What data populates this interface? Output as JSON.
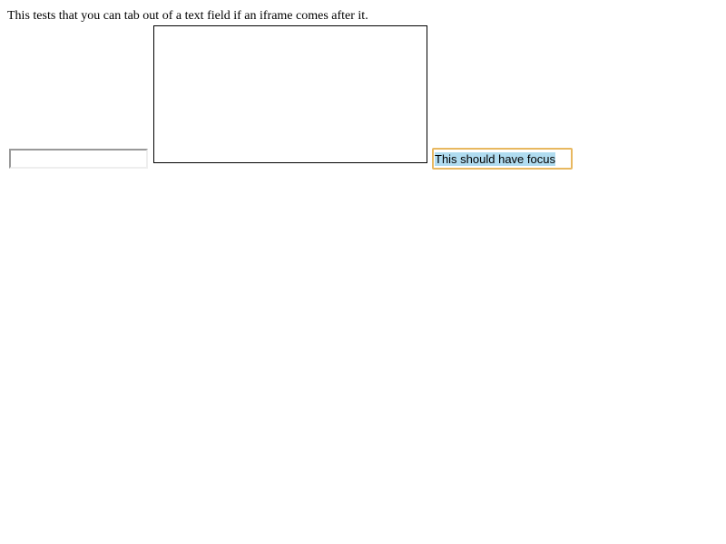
{
  "description": "This tests that you can tab out of a text field if an iframe comes after it.",
  "first_input": {
    "value": ""
  },
  "second_input": {
    "value": "This should have focus",
    "selection_color": "#b0dcf0",
    "focus_color": "#e8b860"
  }
}
